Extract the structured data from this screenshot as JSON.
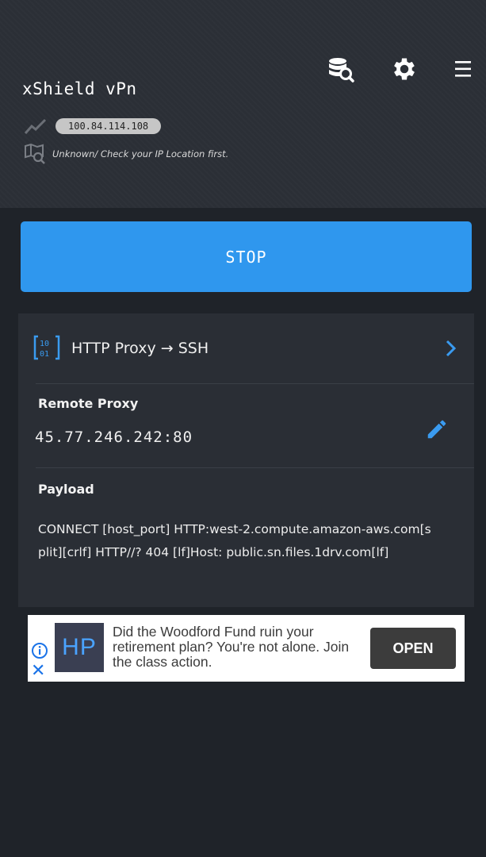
{
  "header": {
    "app_title": "xShield vPn",
    "ip_address": "100.84.114.108",
    "location_text": "Unknown/ Check your IP Location first."
  },
  "toolbar": {
    "icons": [
      "database-search-icon",
      "gear-icon",
      "menu-icon"
    ]
  },
  "main": {
    "stop_label": "STOP",
    "proxy_type": "HTTP Proxy → SSH",
    "remote_proxy_label": "Remote Proxy",
    "remote_proxy_value": "45.77.246.242:80",
    "payload_label": "Payload",
    "payload_value": "CONNECT [host_port] HTTP:west-2.compute.amazon-aws.com[split][crlf] HTTP//? 404 [lf]Host: public.sn.files.1drv.com[lf]"
  },
  "ad": {
    "logo_text": "HP",
    "text": "Did the Woodford Fund ruin your retirement plan? You're not alone. Join the class action.",
    "open_label": "OPEN"
  },
  "colors": {
    "background": "#1f2329",
    "header": "#2b2f36",
    "accent_blue": "#2f97ee",
    "card": "#2a2e35"
  }
}
